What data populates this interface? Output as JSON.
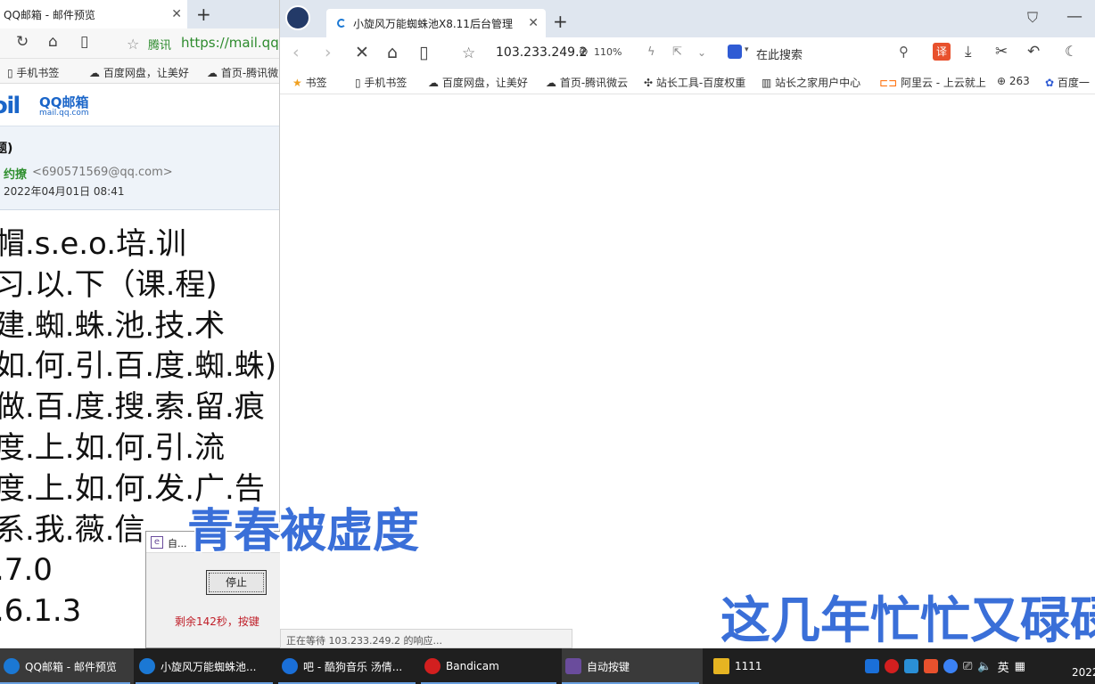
{
  "left_browser": {
    "tab_title": "QQ邮箱 - 邮件预览",
    "new_tab": "+",
    "site_label": "腾讯",
    "url": "https://mail.qq.co",
    "bookmarks": [
      "手机书签",
      "百度网盘，让美好",
      "首页-腾讯微"
    ]
  },
  "mail": {
    "logo_mark": "ɔil",
    "logo_text": "QQ邮箱",
    "logo_sub": "mail.qq.com",
    "subject": "题)",
    "from_name": "约撩",
    "from_addr": "<690571569@qq.com>",
    "date": "2022年04月01日 08:41",
    "body_lines": [
      "帽.s.e.o.培.训",
      "习.以.下（课.程)",
      "建.蜘.蛛.池.技.术",
      "如.何.引.百.度.蜘.蛛)",
      "做.百.度.搜.索.留.痕",
      "度.上.如.何.引.流",
      "度.上.如.何.发.广.告",
      "系.我.薇.信",
      ".7.0",
      ".6.1.3"
    ]
  },
  "dialog": {
    "title": "自...",
    "stop_button": "停止",
    "message": "剩余142秒，按键"
  },
  "right_browser": {
    "tab_title": "小旋风万能蜘蛛池X8.11后台管理",
    "new_tab": "+",
    "address": "103.233.249.2",
    "zoom": "110%",
    "search_placeholder": "在此搜索",
    "translate_label": "译",
    "bookmarks": [
      "书签",
      "手机书签",
      "百度网盘，让美好",
      "首页-腾讯微云",
      "站长工具-百度权重",
      "站长之家用户中心",
      "阿里云 - 上云就上",
      "263",
      "百度一"
    ],
    "status": "正在等待 103.233.249.2 的响应..."
  },
  "overlay": {
    "text1": "青春被虚度",
    "text2": "这几年忙忙又碌碌"
  },
  "taskbar": {
    "items": [
      {
        "label": "QQ邮箱 - 邮件预览",
        "color": "#1b78d4"
      },
      {
        "label": "小旋风万能蜘蛛池...",
        "color": "#1b78d4"
      },
      {
        "label": "吧 - 酷狗音乐 汤倩...",
        "color": "#1a6fd8"
      },
      {
        "label": "Bandicam",
        "color": "#d21f1f"
      },
      {
        "label": "自动按键",
        "color": "#6a4c9c"
      },
      {
        "label": "1111",
        "color": "#e6b422"
      }
    ],
    "ime": "英",
    "clock": "2022"
  }
}
